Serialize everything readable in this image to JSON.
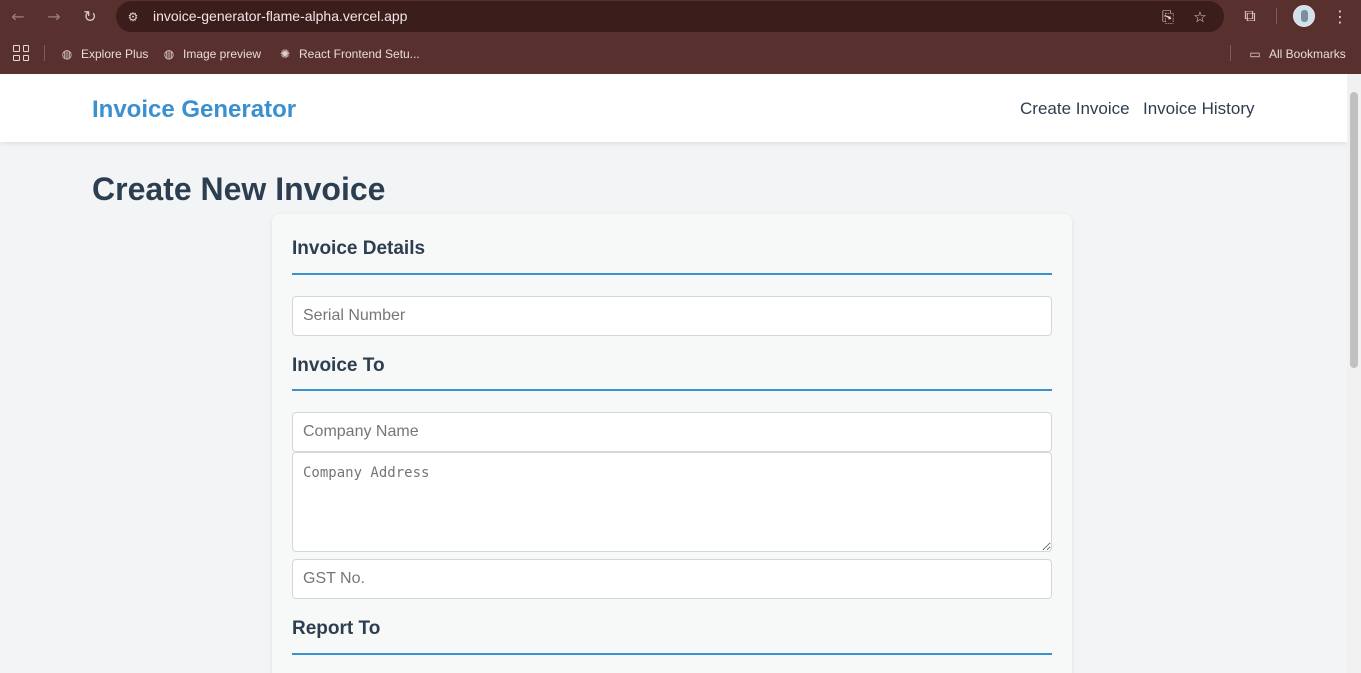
{
  "browser": {
    "url": "invoice-generator-flame-alpha.vercel.app",
    "bookmarks": [
      {
        "label": "Explore Plus",
        "icon": "globe-icon"
      },
      {
        "label": "Image preview",
        "icon": "globe-icon"
      },
      {
        "label": "React Frontend Setu...",
        "icon": "openai-icon"
      }
    ],
    "all_bookmarks_label": "All Bookmarks"
  },
  "app": {
    "brand": "Invoice Generator",
    "brand_color": "#3b90d0",
    "nav": [
      {
        "label": "Create Invoice"
      },
      {
        "label": "Invoice History"
      }
    ]
  },
  "page": {
    "title": "Create New Invoice"
  },
  "form": {
    "invoice_details": {
      "heading": "Invoice Details",
      "serial_placeholder": "Serial Number",
      "serial_value": ""
    },
    "invoice_to": {
      "heading": "Invoice To",
      "company_name_placeholder": "Company Name",
      "company_address_placeholder": "Company Address",
      "gst_placeholder": "GST No."
    },
    "report_to": {
      "heading": "Report To"
    }
  }
}
